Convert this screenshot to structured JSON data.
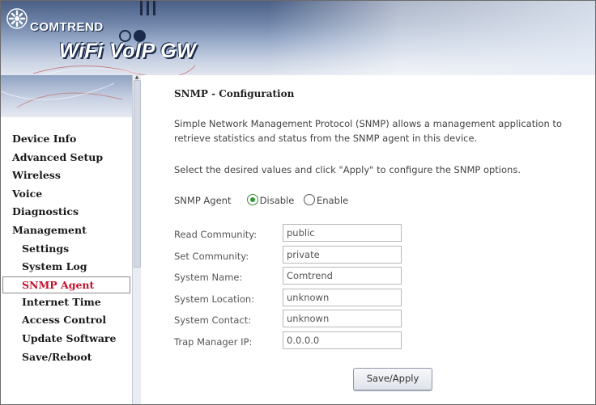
{
  "header": {
    "brand": "COMTREND",
    "product": "WiFi VoIP GW"
  },
  "sidebar": {
    "items": [
      {
        "label": "Device Info",
        "level": 0
      },
      {
        "label": "Advanced Setup",
        "level": 0
      },
      {
        "label": "Wireless",
        "level": 0
      },
      {
        "label": "Voice",
        "level": 0
      },
      {
        "label": "Diagnostics",
        "level": 0
      },
      {
        "label": "Management",
        "level": 0
      },
      {
        "label": "Settings",
        "level": 1
      },
      {
        "label": "System Log",
        "level": 1
      },
      {
        "label": "SNMP Agent",
        "level": 1,
        "active": true
      },
      {
        "label": "Internet Time",
        "level": 1
      },
      {
        "label": "Access Control",
        "level": 1
      },
      {
        "label": "Update Software",
        "level": 1
      },
      {
        "label": "Save/Reboot",
        "level": 1
      }
    ]
  },
  "main": {
    "title": "SNMP - Configuration",
    "description": "Simple Network Management Protocol (SNMP) allows a management application to retrieve statistics and status from the SNMP agent in this device.",
    "instruction": "Select the desired values and click \"Apply\" to configure the SNMP options.",
    "agent": {
      "label": "SNMP Agent",
      "options": [
        "Disable",
        "Enable"
      ],
      "selected": "Disable"
    },
    "fields": [
      {
        "label": "Read Community:",
        "value": "public"
      },
      {
        "label": "Set Community:",
        "value": "private"
      },
      {
        "label": "System Name:",
        "value": "Comtrend"
      },
      {
        "label": "System Location:",
        "value": "unknown"
      },
      {
        "label": "System Contact:",
        "value": "unknown"
      },
      {
        "label": "Trap Manager IP:",
        "value": "0.0.0.0"
      }
    ],
    "apply_label": "Save/Apply"
  },
  "colors": {
    "active_nav": "#c4122e",
    "radio_selected": "#2f9a2f",
    "header_dark": "#1b2a4a"
  }
}
